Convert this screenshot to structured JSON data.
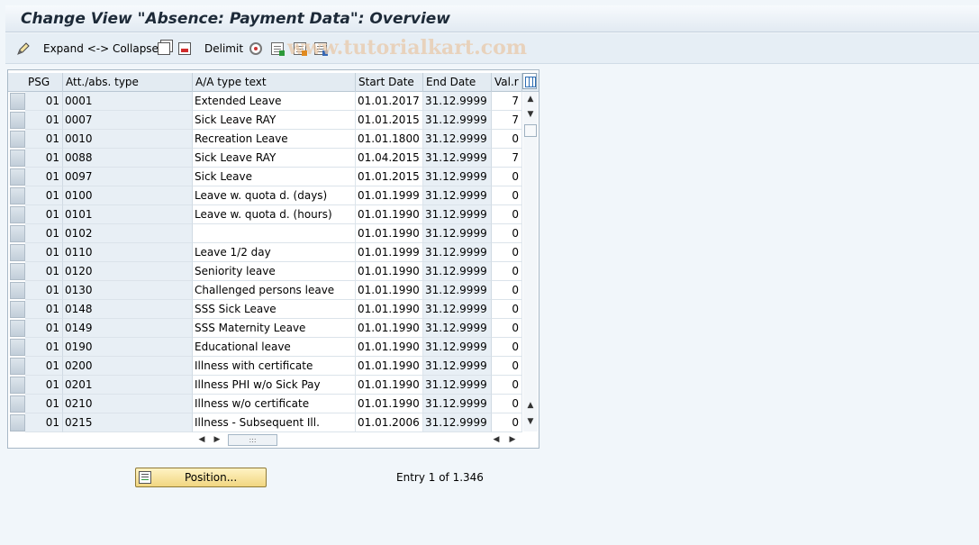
{
  "window": {
    "title": "Change View \"Absence: Payment Data\": Overview"
  },
  "toolbar": {
    "expand_collapse_label": "Expand <-> Collapse",
    "delimit_label": "Delimit",
    "watermark": "www.tutorialkart.com",
    "icons": [
      "pencil-icon",
      "copy-icon",
      "delete-icon",
      "gear-icon",
      "select-all-icon",
      "deselect-icon",
      "select-block-icon"
    ]
  },
  "table": {
    "columns": [
      "PSG",
      "Att./abs. type",
      "A/A type text",
      "Start Date",
      "End Date",
      "Val.r"
    ],
    "rows": [
      {
        "psg": "01",
        "type": "0001",
        "text": "Extended Leave",
        "start": "01.01.2017",
        "end": "31.12.9999",
        "val": "7"
      },
      {
        "psg": "01",
        "type": "0007",
        "text": "Sick Leave RAY",
        "start": "01.01.2015",
        "end": "31.12.9999",
        "val": "7"
      },
      {
        "psg": "01",
        "type": "0010",
        "text": "Recreation Leave",
        "start": "01.01.1800",
        "end": "31.12.9999",
        "val": "0"
      },
      {
        "psg": "01",
        "type": "0088",
        "text": "Sick Leave RAY",
        "start": "01.04.2015",
        "end": "31.12.9999",
        "val": "7"
      },
      {
        "psg": "01",
        "type": "0097",
        "text": "Sick Leave",
        "start": "01.01.2015",
        "end": "31.12.9999",
        "val": "0"
      },
      {
        "psg": "01",
        "type": "0100",
        "text": "Leave w. quota d. (days)",
        "start": "01.01.1999",
        "end": "31.12.9999",
        "val": "0"
      },
      {
        "psg": "01",
        "type": "0101",
        "text": "Leave w. quota d. (hours)",
        "start": "01.01.1990",
        "end": "31.12.9999",
        "val": "0"
      },
      {
        "psg": "01",
        "type": "0102",
        "text": "",
        "start": "01.01.1990",
        "end": "31.12.9999",
        "val": "0"
      },
      {
        "psg": "01",
        "type": "0110",
        "text": "Leave 1/2 day",
        "start": "01.01.1999",
        "end": "31.12.9999",
        "val": "0"
      },
      {
        "psg": "01",
        "type": "0120",
        "text": "Seniority leave",
        "start": "01.01.1990",
        "end": "31.12.9999",
        "val": "0"
      },
      {
        "psg": "01",
        "type": "0130",
        "text": "Challenged persons leave",
        "start": "01.01.1990",
        "end": "31.12.9999",
        "val": "0"
      },
      {
        "psg": "01",
        "type": "0148",
        "text": "SSS Sick Leave",
        "start": "01.01.1990",
        "end": "31.12.9999",
        "val": "0"
      },
      {
        "psg": "01",
        "type": "0149",
        "text": "SSS Maternity Leave",
        "start": "01.01.1990",
        "end": "31.12.9999",
        "val": "0"
      },
      {
        "psg": "01",
        "type": "0190",
        "text": "Educational leave",
        "start": "01.01.1990",
        "end": "31.12.9999",
        "val": "0"
      },
      {
        "psg": "01",
        "type": "0200",
        "text": "Illness with certificate",
        "start": "01.01.1990",
        "end": "31.12.9999",
        "val": "0"
      },
      {
        "psg": "01",
        "type": "0201",
        "text": "Illness PHI w/o Sick Pay",
        "start": "01.01.1990",
        "end": "31.12.9999",
        "val": "0"
      },
      {
        "psg": "01",
        "type": "0210",
        "text": "Illness w/o certificate",
        "start": "01.01.1990",
        "end": "31.12.9999",
        "val": "0"
      },
      {
        "psg": "01",
        "type": "0215",
        "text": "Illness - Subsequent Ill.",
        "start": "01.01.2006",
        "end": "31.12.9999",
        "val": "0"
      }
    ]
  },
  "footer": {
    "position_label": "Position...",
    "entry_text": "Entry 1 of 1.346"
  }
}
